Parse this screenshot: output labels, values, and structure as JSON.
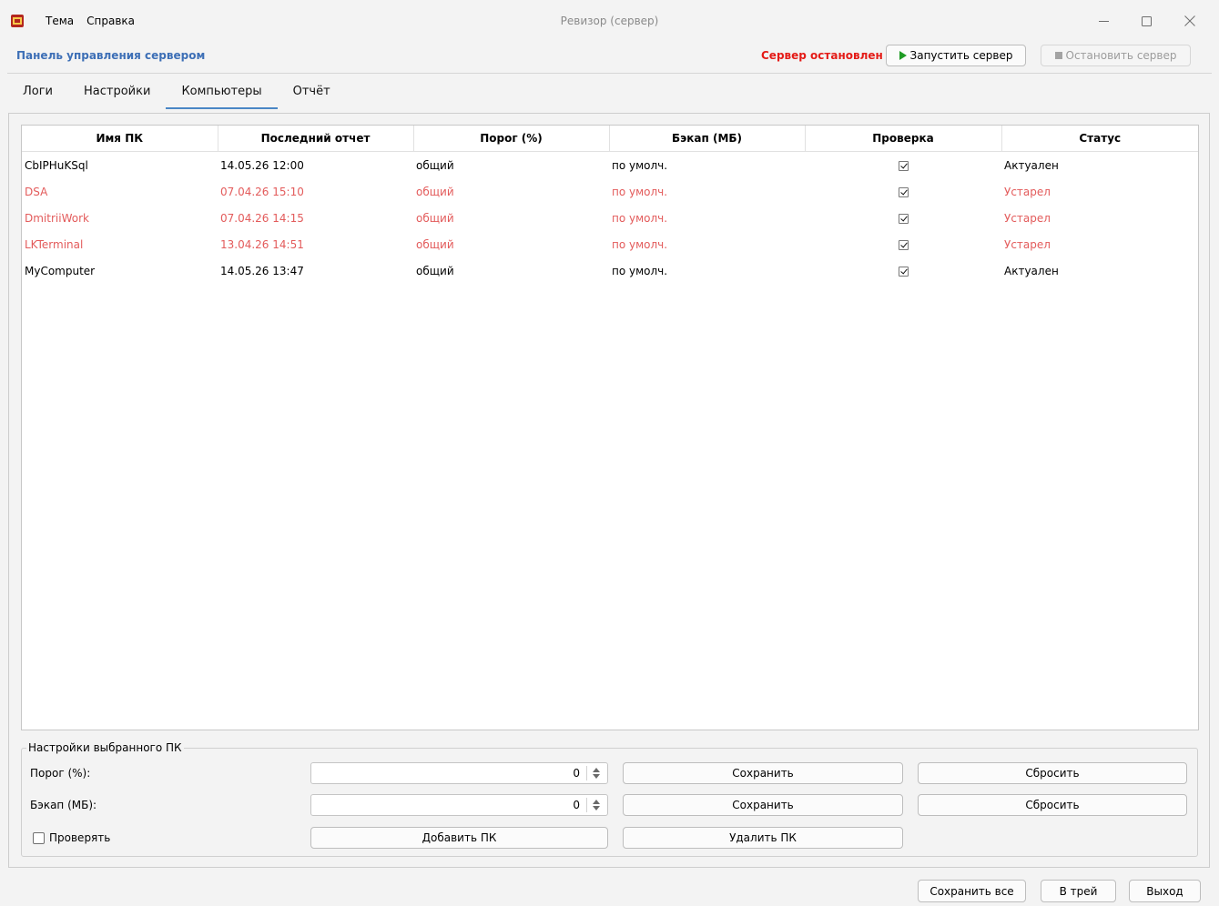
{
  "window": {
    "title": "Ревизор (сервер)",
    "menu": [
      "Тема",
      "Справка"
    ]
  },
  "control_bar": {
    "panel_title": "Панель управления сервером",
    "server_status": "Сервер остановлен",
    "start_label": "Запустить сервер",
    "stop_label": "Остановить сервер"
  },
  "tabs": [
    "Логи",
    "Настройки",
    "Компьютеры",
    "Отчёт"
  ],
  "active_tab": "Компьютеры",
  "table": {
    "columns": [
      "Имя ПК",
      "Последний отчет",
      "Порог (%)",
      "Бэкап (МБ)",
      "Проверка",
      "Статус"
    ],
    "rows": [
      {
        "name": "CbIPHuKSql",
        "last_report": "14.05.26 12:00",
        "threshold": "общий",
        "backup": "по умолч.",
        "check": true,
        "status": "Актуален",
        "stale": false
      },
      {
        "name": "DSA",
        "last_report": "07.04.26 15:10",
        "threshold": "общий",
        "backup": "по умолч.",
        "check": true,
        "status": "Устарел",
        "stale": true
      },
      {
        "name": "DmitriiWork",
        "last_report": "07.04.26 14:15",
        "threshold": "общий",
        "backup": "по умолч.",
        "check": true,
        "status": "Устарел",
        "stale": true
      },
      {
        "name": "LKTerminal",
        "last_report": "13.04.26 14:51",
        "threshold": "общий",
        "backup": "по умолч.",
        "check": true,
        "status": "Устарел",
        "stale": true
      },
      {
        "name": "MyComputer",
        "last_report": "14.05.26 13:47",
        "threshold": "общий",
        "backup": "по умолч.",
        "check": true,
        "status": "Актуален",
        "stale": false
      }
    ]
  },
  "settings": {
    "title": "Настройки выбранного ПК",
    "threshold_label": "Порог (%):",
    "threshold_value": "0",
    "backup_label": "Бэкап (МБ):",
    "backup_value": "0",
    "save_label": "Сохранить",
    "reset_label": "Сбросить",
    "check_label": "Проверять",
    "check_checked": false,
    "add_pc_label": "Добавить ПК",
    "delete_pc_label": "Удалить ПК"
  },
  "footer": {
    "save_all_label": "Сохранить все",
    "tray_label": "В трей",
    "exit_label": "Выход"
  },
  "colors": {
    "accent_title": "#3d6fb6",
    "status_stopped": "#e41b17",
    "stale_row": "#e35b5b",
    "play_icon": "#1e9b23",
    "tab_underline": "#4a86c5"
  }
}
